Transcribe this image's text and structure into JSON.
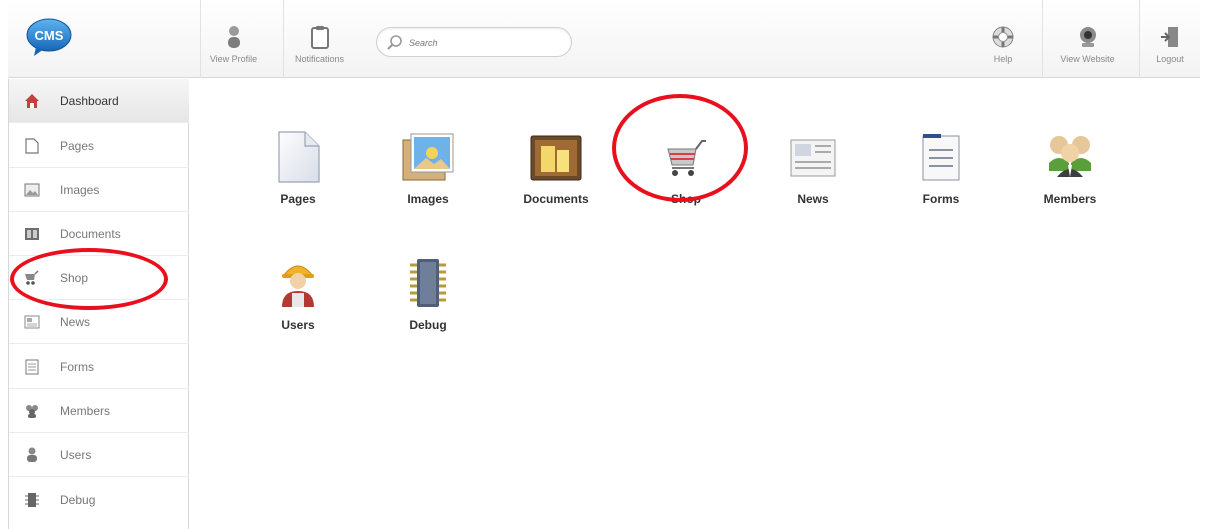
{
  "header": {
    "logo_text": "CMS",
    "view_profile": "View Profile",
    "notifications": "Notifications",
    "search_placeholder": "Search",
    "help": "Help",
    "view_website": "View Website",
    "logout": "Logout"
  },
  "sidebar": {
    "items": [
      {
        "label": "Dashboard",
        "icon": "home-icon"
      },
      {
        "label": "Pages",
        "icon": "page-icon"
      },
      {
        "label": "Images",
        "icon": "image-icon"
      },
      {
        "label": "Documents",
        "icon": "document-icon"
      },
      {
        "label": "Shop",
        "icon": "cart-icon"
      },
      {
        "label": "News",
        "icon": "news-icon"
      },
      {
        "label": "Forms",
        "icon": "form-icon"
      },
      {
        "label": "Members",
        "icon": "members-icon"
      },
      {
        "label": "Users",
        "icon": "user-icon"
      },
      {
        "label": "Debug",
        "icon": "debug-icon"
      }
    ]
  },
  "dashboard": {
    "tiles": [
      {
        "label": "Pages"
      },
      {
        "label": "Images"
      },
      {
        "label": "Documents"
      },
      {
        "label": "Shop"
      },
      {
        "label": "News"
      },
      {
        "label": "Forms"
      },
      {
        "label": "Members"
      },
      {
        "label": "Users"
      },
      {
        "label": "Debug"
      }
    ]
  },
  "colors": {
    "highlight_circle": "#e8101c",
    "logo_blue": "#1e7fd0"
  }
}
